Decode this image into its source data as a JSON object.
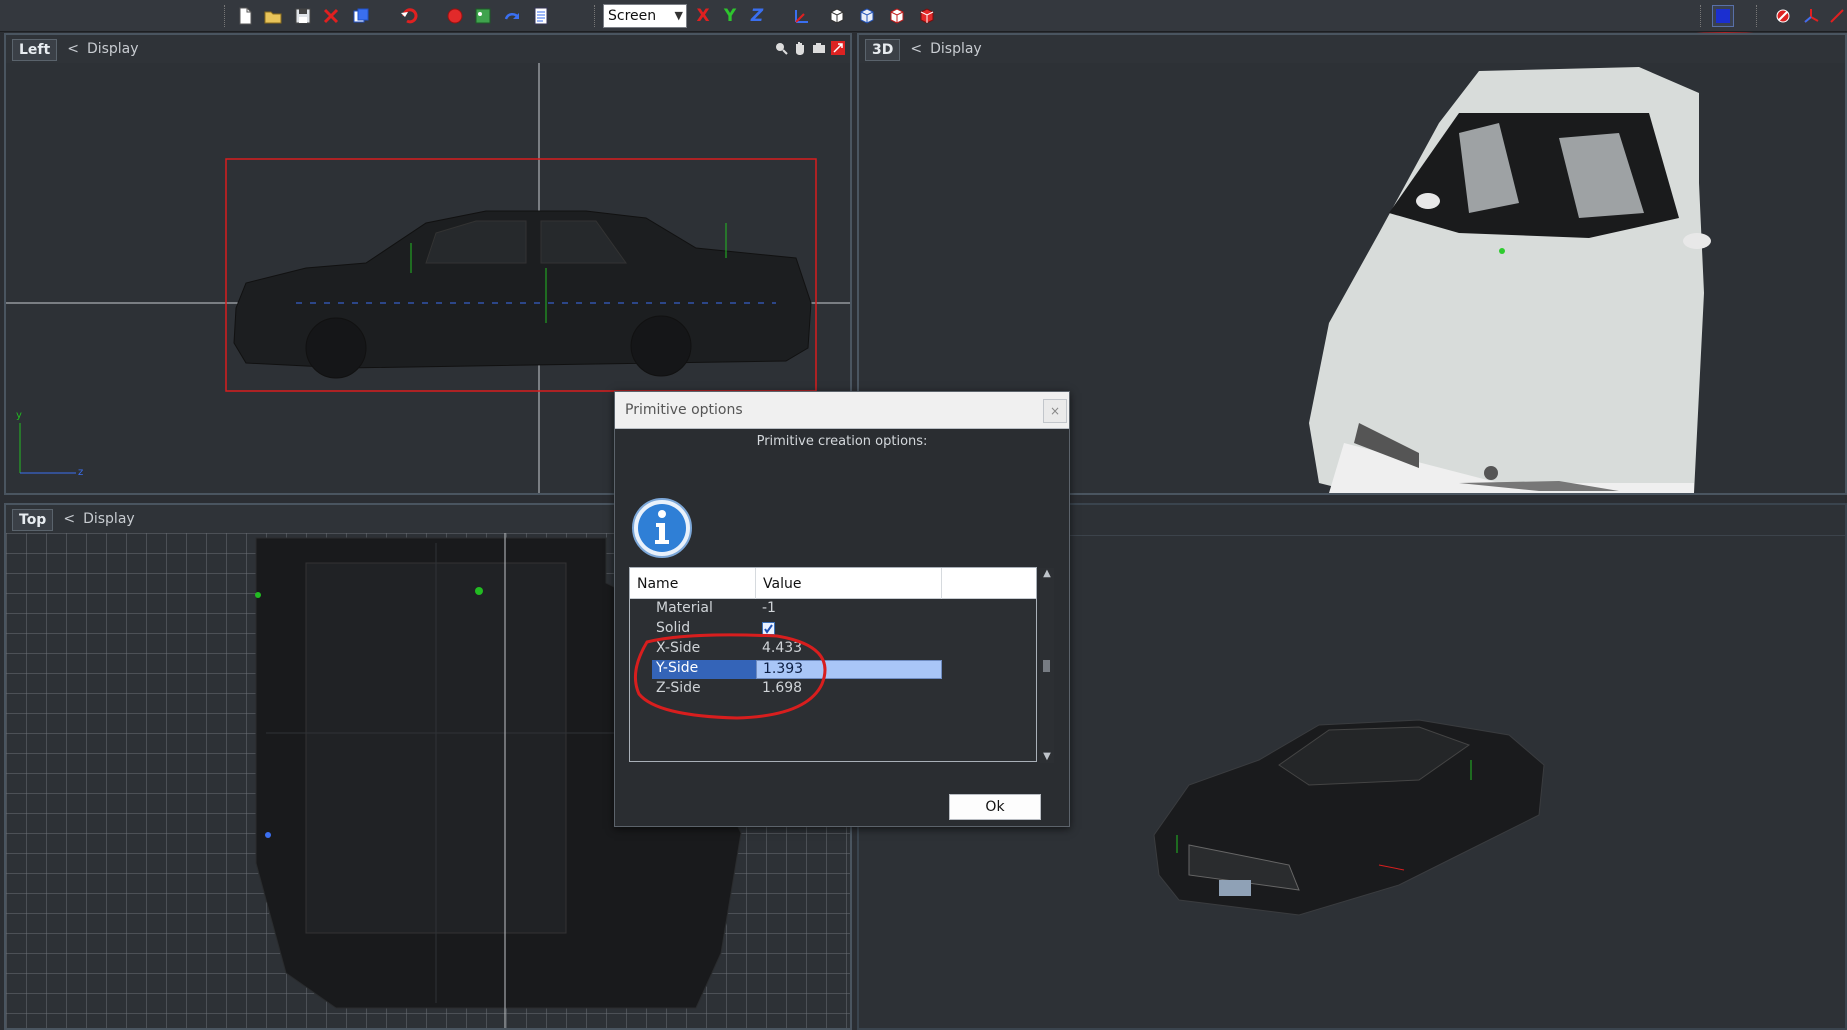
{
  "toolbar": {
    "screen_select_value": "Screen",
    "axis_x": "X",
    "axis_y": "Y",
    "axis_z": "Z",
    "icons": [
      "new-file-icon",
      "open-folder-icon",
      "save-icon",
      "delete-icon",
      "copy-icon",
      "undo-icon",
      "record-icon",
      "image-icon",
      "redo-icon",
      "document-icon",
      "cube-icon",
      "cube-outline-icon",
      "cube-red-icon",
      "cube-white-icon",
      "globe-icon",
      "tools-icon",
      "axes-icon"
    ]
  },
  "viewports": {
    "left": {
      "name": "Left",
      "nav": "<",
      "display": "Display"
    },
    "view3d": {
      "name": "3D",
      "nav": "<",
      "display": "Display"
    },
    "top": {
      "name": "Top",
      "nav": "<",
      "display": "Display"
    },
    "axes": {
      "y": "y",
      "z": "z"
    }
  },
  "dialog": {
    "title": "Primitive options",
    "close": "×",
    "subtitle": "Primitive creation options:",
    "columns": {
      "name": "Name",
      "value": "Value"
    },
    "rows": [
      {
        "name": "Material",
        "value": "-1"
      },
      {
        "name": "Solid",
        "value": ""
      },
      {
        "name": "X-Side",
        "value": "4.433"
      },
      {
        "name": "Y-Side",
        "value": "1.393"
      },
      {
        "name": "Z-Side",
        "value": "1.698"
      }
    ],
    "ok_label": "Ok"
  },
  "colors": {
    "accent_red": "#d81e1e",
    "selection_blue": "#3464b8",
    "viewport_bg": "#2d3136"
  }
}
